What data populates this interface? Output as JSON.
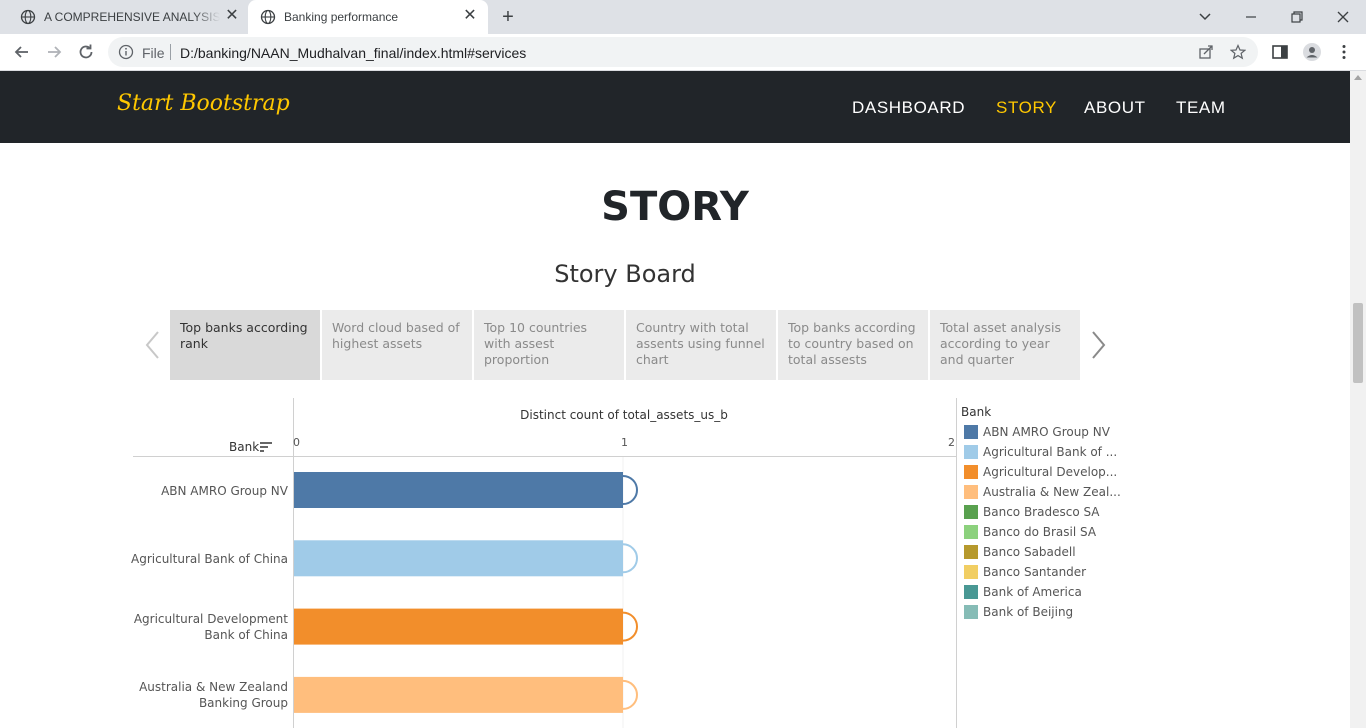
{
  "browser": {
    "tabs": [
      {
        "title": "A COMPREHENSIVE ANALYSIS OF",
        "active": false
      },
      {
        "title": "Banking performance",
        "active": true
      }
    ],
    "address": {
      "scheme_label": "File",
      "url": "D:/banking/NAAN_Mudhalvan_final/index.html#services"
    }
  },
  "navbar": {
    "brand": "Start Bootstrap",
    "links": [
      {
        "label": "DASHBOARD",
        "active": false
      },
      {
        "label": "STORY",
        "active": true
      },
      {
        "label": "ABOUT",
        "active": false
      },
      {
        "label": "TEAM",
        "active": false
      }
    ]
  },
  "section": {
    "title": "STORY"
  },
  "storyboard": {
    "title": "Story Board",
    "tabs": [
      {
        "label": "Top banks according rank",
        "active": true
      },
      {
        "label": "Word cloud based of highest assets",
        "active": false
      },
      {
        "label": "Top 10 countries with assest proportion",
        "active": false
      },
      {
        "label": "Country with total assents using funnel chart",
        "active": false
      },
      {
        "label": "Top banks according to country based on total assests",
        "active": false
      },
      {
        "label": "Total asset analysis according to year and quarter",
        "active": false
      }
    ]
  },
  "chart_data": {
    "type": "bar",
    "orientation": "horizontal",
    "xlabel": "Distinct count of total_assets_us_b",
    "ylabel": "Bank",
    "xlim": [
      0,
      2
    ],
    "xticks": [
      "0",
      "1",
      "2"
    ],
    "categories": [
      "ABN AMRO Group NV",
      "Agricultural Bank of China",
      "Agricultural Development Bank of China",
      "Australia & New Zealand Banking Group"
    ],
    "category_lines": [
      [
        "ABN AMRO Group NV"
      ],
      [
        "Agricultural Bank of China"
      ],
      [
        "Agricultural Development",
        "Bank of China"
      ],
      [
        "Australia & New Zealand",
        "Banking Group"
      ]
    ],
    "values": [
      1,
      1,
      1,
      1
    ],
    "bar_colors": [
      "#4e79a7",
      "#a0cbe8",
      "#f28e2b",
      "#ffbe7d"
    ],
    "legend": {
      "title": "Bank",
      "placement": "right",
      "items": [
        {
          "label": "ABN AMRO Group NV",
          "color": "#4e79a7"
        },
        {
          "label": "Agricultural Bank of ...",
          "color": "#a0cbe8"
        },
        {
          "label": "Agricultural Develop...",
          "color": "#f28e2b"
        },
        {
          "label": "Australia & New Zeal...",
          "color": "#ffbe7d"
        },
        {
          "label": "Banco Bradesco SA",
          "color": "#59a14f"
        },
        {
          "label": "Banco do Brasil SA",
          "color": "#8cd17d"
        },
        {
          "label": "Banco Sabadell",
          "color": "#b6992d"
        },
        {
          "label": "Banco Santander",
          "color": "#f1ce63"
        },
        {
          "label": "Bank of America",
          "color": "#499894"
        },
        {
          "label": "Bank of Beijing",
          "color": "#86bcb6"
        }
      ]
    },
    "grid": false
  }
}
